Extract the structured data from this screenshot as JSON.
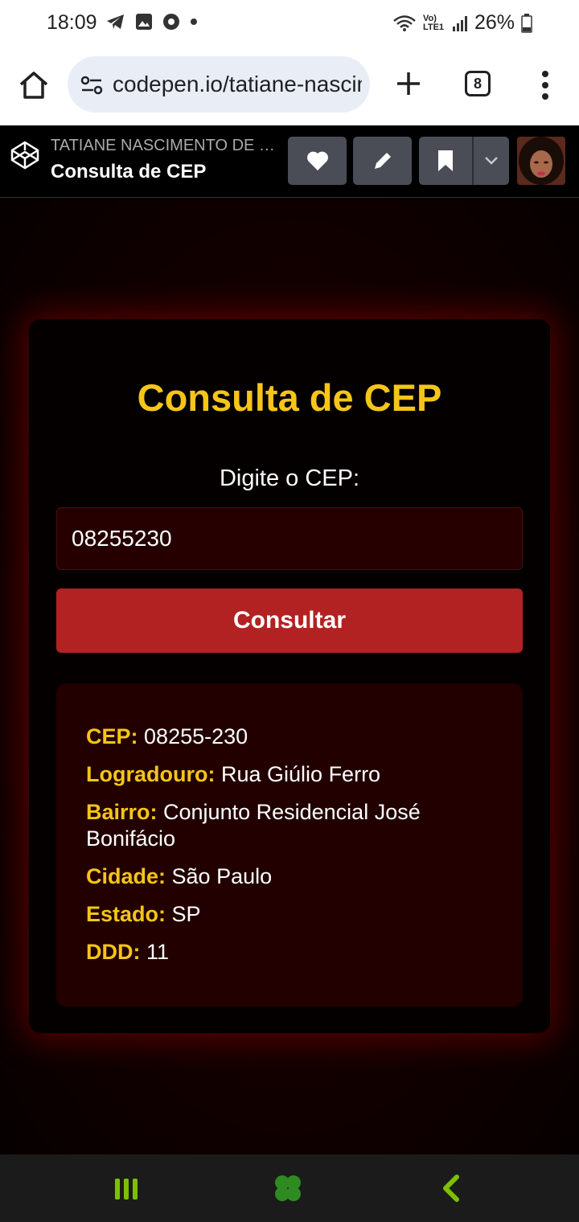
{
  "status_bar": {
    "time": "18:09",
    "network": "Vo) LTE1",
    "battery": "26%"
  },
  "browser": {
    "url": "codepen.io/tatiane-nascimento",
    "tab_count": "8"
  },
  "codepen": {
    "author": "TATIANE NASCIMENTO DE S...",
    "pen_title": "Consulta de CEP"
  },
  "app": {
    "title": "Consulta de CEP",
    "input_label": "Digite o CEP:",
    "input_value": "08255230",
    "button_label": "Consultar",
    "result": [
      {
        "key": "CEP:",
        "value": "08255-230"
      },
      {
        "key": "Logradouro:",
        "value": "Rua Giúlio Ferro"
      },
      {
        "key": "Bairro:",
        "value": "Conjunto Residencial José Bonifácio"
      },
      {
        "key": "Cidade:",
        "value": "São Paulo"
      },
      {
        "key": "Estado:",
        "value": "SP"
      },
      {
        "key": "DDD:",
        "value": "11"
      }
    ]
  },
  "colors": {
    "accent_yellow": "#f5c518",
    "button_red": "#b22222",
    "nav_green": "#7cc000"
  }
}
